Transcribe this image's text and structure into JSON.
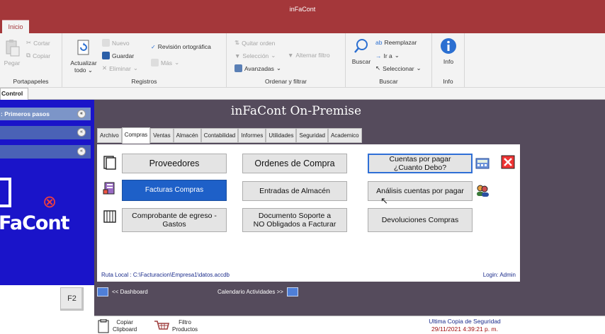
{
  "app": {
    "title": "inFaCont"
  },
  "ribbon": {
    "tab": "Inicio",
    "portapapeles": {
      "label": "Portapapeles",
      "pegar": "Pegar",
      "cortar": "Cortar",
      "copiar": "Copiar"
    },
    "registros": {
      "label": "Registros",
      "actualizar_1": "Actualizar",
      "actualizar_2": "todo",
      "nuevo": "Nuevo",
      "guardar": "Guardar",
      "eliminar": "Eliminar",
      "revision": "Revisión ortográfica",
      "mas": "Más"
    },
    "filtro": {
      "label": "Ordenar y filtrar",
      "quitar": "Quitar orden",
      "seleccion": "Selección",
      "alternar": "Alternar filtro",
      "avanzadas": "Avanzadas"
    },
    "buscar": {
      "label": "Buscar",
      "buscar": "Buscar",
      "reemplazar": "Reemplazar",
      "ir_a": "Ir a",
      "seleccionar": "Seleccionar"
    },
    "info": {
      "label": "Info",
      "info": "Info"
    }
  },
  "doc_tab": "Control",
  "nav": {
    "header": ": Primeros pasos",
    "chevron": "«",
    "logo": "FaCont",
    "f2": "F2"
  },
  "form": {
    "title": "inFaCont On-Premise",
    "tabs": [
      "Archivo",
      "Compras",
      "Ventas",
      "Almacén",
      "Contabilidad",
      "Informes",
      "Utilidades",
      "Seguridad",
      "Academico"
    ],
    "active_tab": "Compras",
    "buttons": {
      "proveedores": "Proveedores",
      "ordenes": "Ordenes de Compra",
      "cuentas_1": "Cuentas por pagar",
      "cuentas_2": "¿Cuanto Debo?",
      "facturas": "Facturas Compras",
      "entradas": "Entradas de Almacén",
      "analisis": "Análisis cuentas por pagar",
      "comprobante_1": "Comprobante de egreso -",
      "comprobante_2": "Gastos",
      "documento_1": "Documento Soporte a",
      "documento_2": "NO Obligados a Facturar",
      "devoluciones": "Devoluciones Compras"
    },
    "ruta": "Ruta Local : C:\\Facturacion\\Empresa1\\datos.accdb",
    "login": "Login: Admin",
    "dashboard": "<< Dashboard",
    "calendario": "Calendario Actividades >>"
  },
  "status": {
    "copiar_1": "Copiar",
    "copiar_2": "Clipboard",
    "filtro_1": "Filtro",
    "filtro_2": "Productos",
    "backup_label": "Ultima Copia de Seguridad",
    "backup_date": "29/11/2021 4:39:21 p. m."
  },
  "colors": {
    "titlebar": "#a4373a",
    "form_bg": "#554b5c",
    "nav_bg": "#1a14c9",
    "accent_blue": "#1e60c8"
  }
}
